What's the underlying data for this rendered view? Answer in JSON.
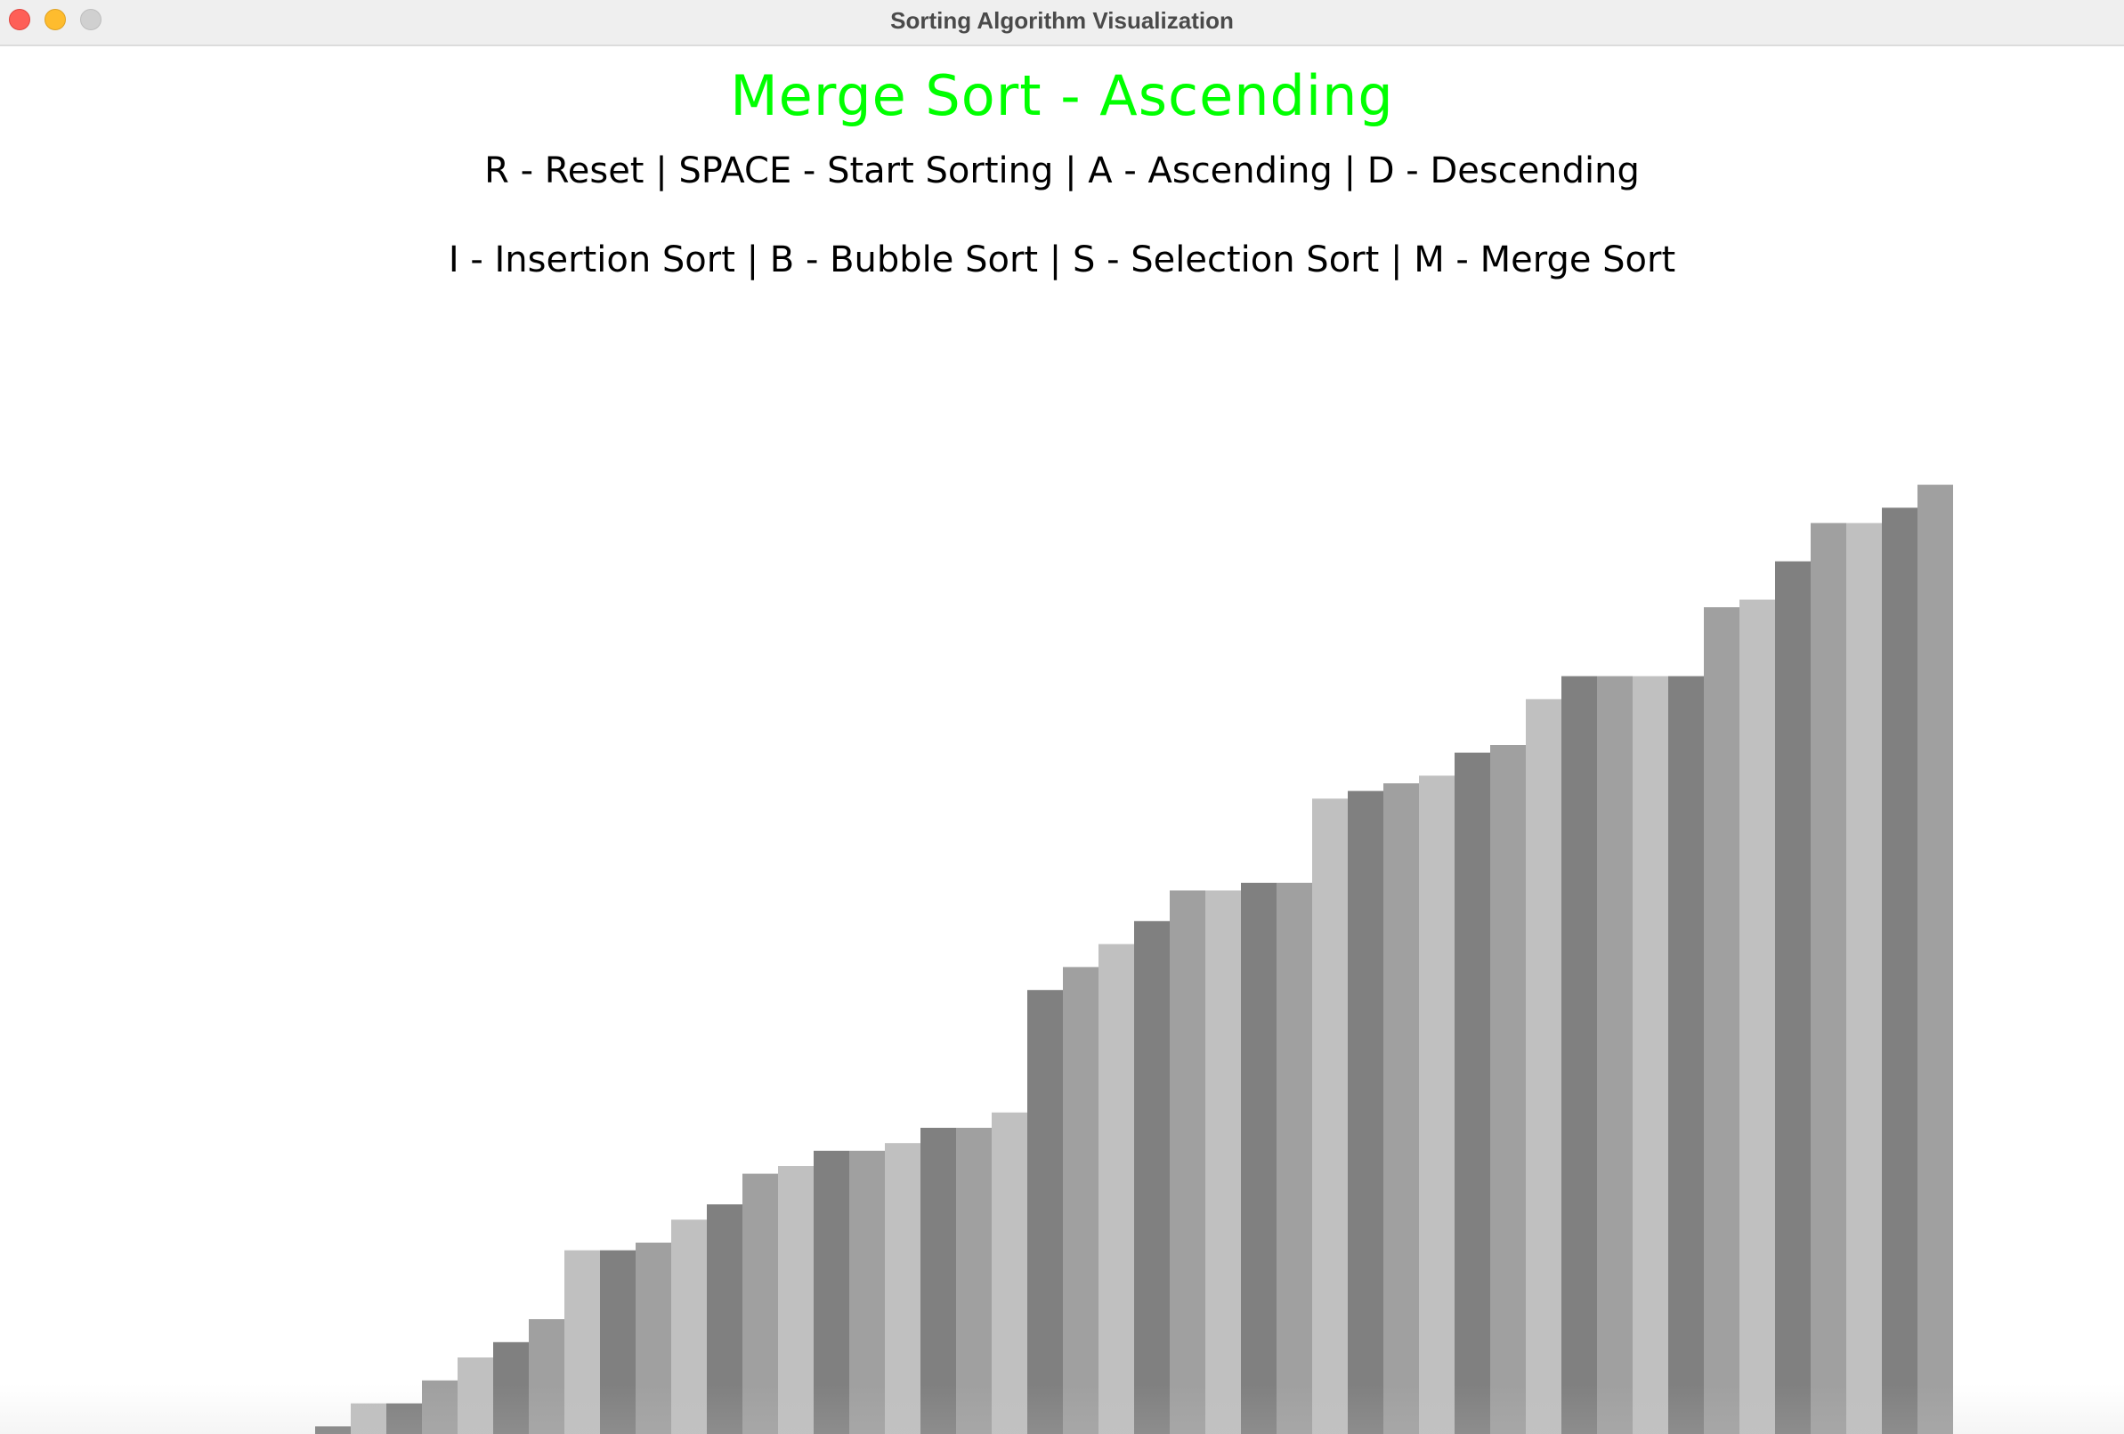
{
  "window": {
    "title": "Sorting Algorithm Visualization"
  },
  "header": {
    "algorithm_title": "Merge Sort - Ascending",
    "controls_line_1": "R - Reset | SPACE - Start Sorting | A - Ascending | D - Descending",
    "controls_line_2": "I - Insertion Sort | B - Bubble Sort | S - Selection Sort | M - Merge Sort"
  },
  "colors": {
    "title": "#00ff00",
    "text": "#000000",
    "bar_shades": [
      "#808080",
      "#a0a0a0",
      "#c0c0c0"
    ]
  },
  "chart_data": {
    "type": "bar",
    "sorted_order": "ascending",
    "values": [
      1,
      4,
      4,
      7,
      10,
      12,
      15,
      24,
      24,
      25,
      28,
      30,
      34,
      35,
      37,
      37,
      38,
      40,
      40,
      42,
      58,
      61,
      64,
      67,
      71,
      71,
      72,
      72,
      83,
      84,
      85,
      86,
      89,
      90,
      96,
      99,
      99,
      99,
      99,
      108,
      109,
      114,
      119,
      119,
      121,
      124
    ],
    "shade_index": [
      0,
      2,
      0,
      1,
      2,
      0,
      1,
      2,
      0,
      1,
      2,
      0,
      1,
      2,
      0,
      1,
      2,
      0,
      1,
      2,
      0,
      1,
      2,
      0,
      1,
      2,
      0,
      1,
      2,
      0,
      1,
      2,
      0,
      1,
      2,
      0,
      1,
      2,
      0,
      1,
      2,
      0,
      1,
      2,
      0,
      1
    ],
    "ylim": [
      0,
      125
    ]
  }
}
